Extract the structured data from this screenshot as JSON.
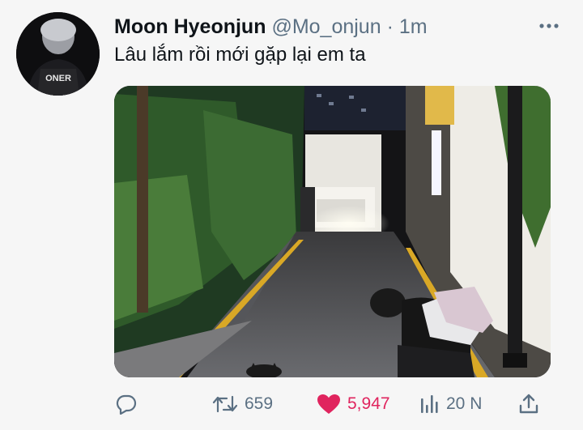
{
  "author": {
    "name": "Moon Hyeonjun",
    "handle": "@Mo_onjun",
    "separator": "·",
    "time": "1m",
    "avatar_text": "ONER"
  },
  "tweet": {
    "text": "Lâu lắm rồi mới gặp lại em ta"
  },
  "actions": {
    "reply_icon": "speech-bubble-icon",
    "retweet_icon": "retweet-icon",
    "retweet_count": "659",
    "like_icon": "heart-icon",
    "like_count": "5,947",
    "views_icon": "bar-chart-icon",
    "views_count": "20 N",
    "share_icon": "share-icon"
  },
  "colors": {
    "like": "#e0245e",
    "secondary_text": "#5b7083",
    "primary_text": "#0f1419",
    "background": "#f6f6f6"
  }
}
